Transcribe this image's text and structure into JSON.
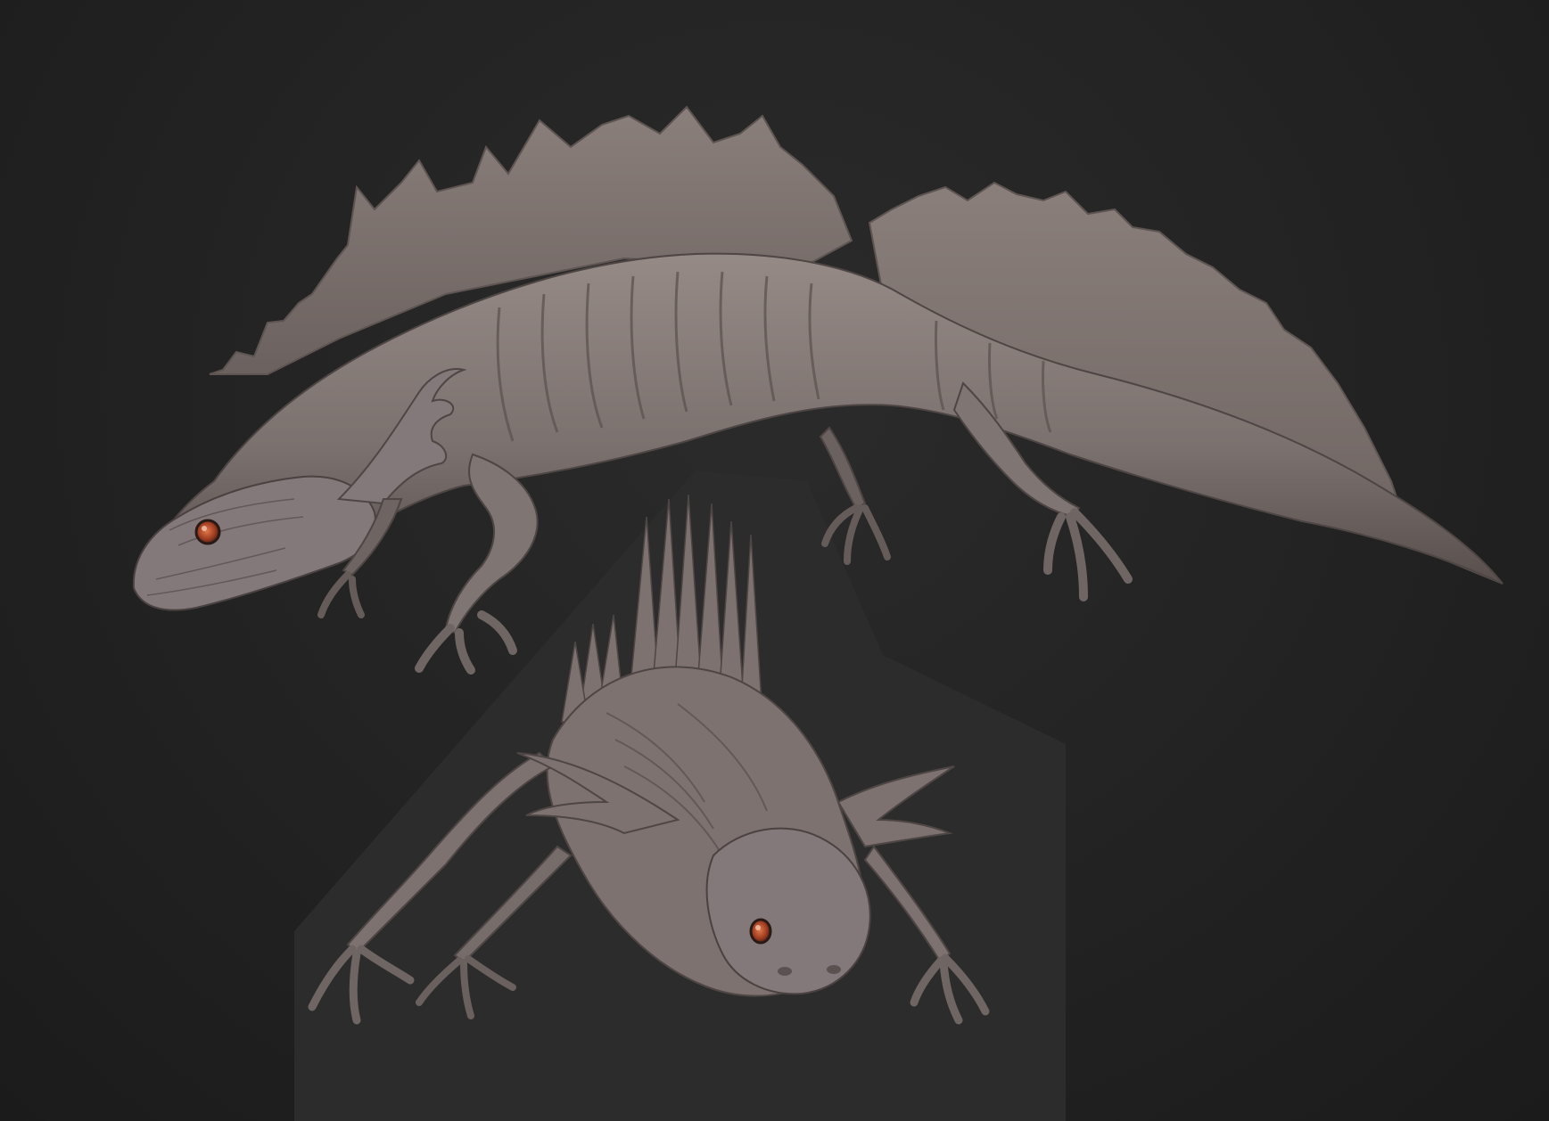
{
  "scene": {
    "background_color": "#242424",
    "backdrop_panel_color": "#2d2d2d",
    "clay_color": "#7d726f",
    "clay_highlight": "#9a8f8b",
    "clay_shadow": "#4a4240",
    "eye_color": "#b3492a"
  },
  "views": [
    {
      "view": "side"
    },
    {
      "view": "front"
    }
  ]
}
